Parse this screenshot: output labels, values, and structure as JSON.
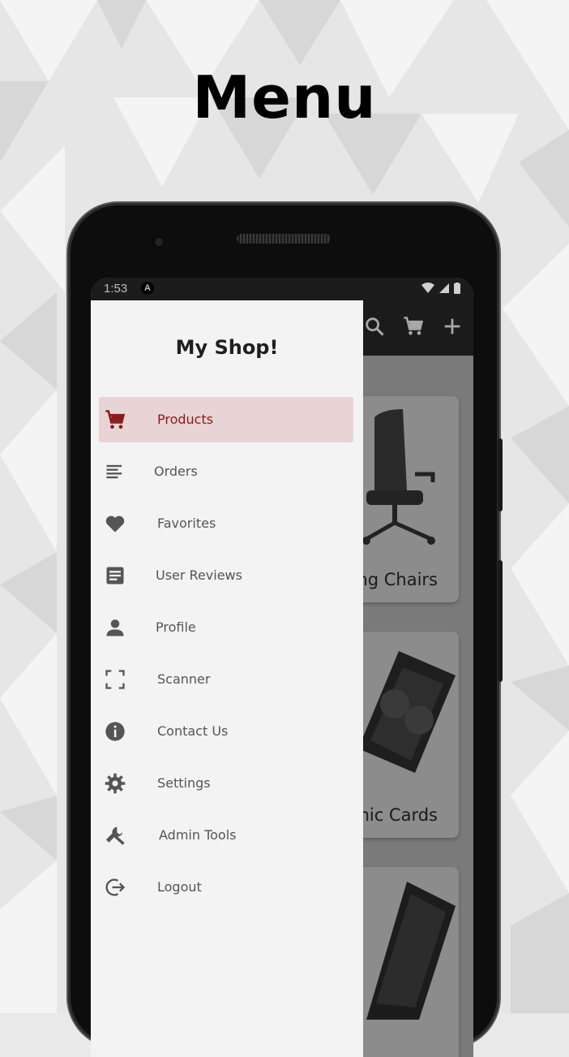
{
  "headline": "Menu",
  "status_bar": {
    "time": "1:53",
    "notification_glyph": "A"
  },
  "app_bar": {
    "icons": [
      "search-icon",
      "cart-icon",
      "add-icon"
    ]
  },
  "drawer": {
    "title": "My Shop!",
    "accent_color": "#8b1a1a",
    "active_bg": "#e8d4d4",
    "items": [
      {
        "label": "Products",
        "icon": "cart-icon",
        "active": true
      },
      {
        "label": "Orders",
        "icon": "list-icon",
        "active": false
      },
      {
        "label": "Favorites",
        "icon": "heart-icon",
        "active": false
      },
      {
        "label": "User Reviews",
        "icon": "article-icon",
        "active": false
      },
      {
        "label": "Profile",
        "icon": "person-icon",
        "active": false
      },
      {
        "label": "Scanner",
        "icon": "scan-frame-icon",
        "active": false
      },
      {
        "label": "Contact Us",
        "icon": "info-icon",
        "active": false
      },
      {
        "label": "Settings",
        "icon": "gear-icon",
        "active": false
      },
      {
        "label": "Admin Tools",
        "icon": "wrench-icon",
        "active": false
      },
      {
        "label": "Logout",
        "icon": "logout-icon",
        "active": false
      }
    ]
  },
  "background_cards": [
    {
      "label": "ng Chairs"
    },
    {
      "label": "hic Cards"
    },
    {
      "label": ""
    }
  ]
}
